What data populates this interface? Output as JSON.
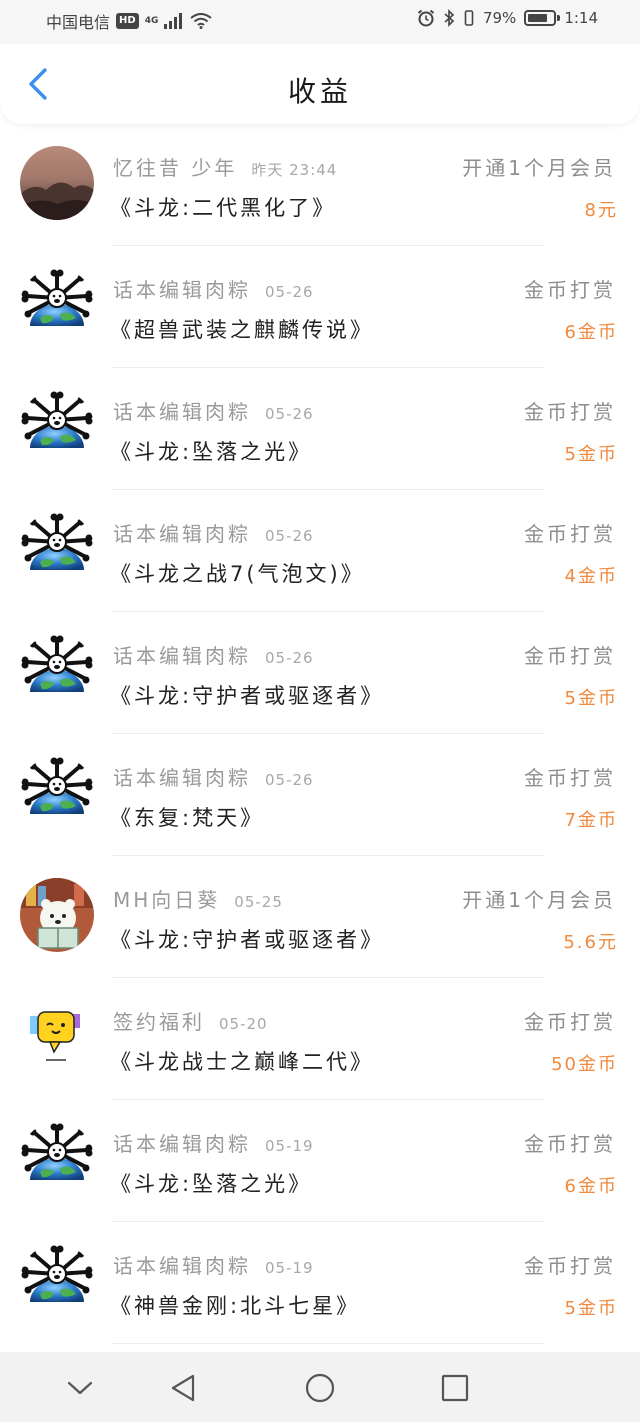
{
  "status_bar": {
    "carrier": "中国电信",
    "hd": "HD",
    "network": "4G",
    "battery_text": "79%",
    "battery_level": 0.79,
    "time": "1:14"
  },
  "header": {
    "title": "收益",
    "back_icon": "chevron-left-icon"
  },
  "colors": {
    "accent_blue": "#3b8ff0",
    "amount_orange": "#f08a3e"
  },
  "rows": [
    {
      "avatar": "mountain-photo",
      "name": "忆往昔 少年",
      "time": "昨天 23:44",
      "type": "开通1个月会员",
      "title": "《斗龙:二代黑化了》",
      "amount": "8元"
    },
    {
      "avatar": "bone-globe",
      "name": "话本编辑肉粽",
      "time": "05-26",
      "type": "金币打赏",
      "title": "《超兽武装之麒麟传说》",
      "amount": "6金币"
    },
    {
      "avatar": "bone-globe",
      "name": "话本编辑肉粽",
      "time": "05-26",
      "type": "金币打赏",
      "title": "《斗龙:坠落之光》",
      "amount": "5金币"
    },
    {
      "avatar": "bone-globe",
      "name": "话本编辑肉粽",
      "time": "05-26",
      "type": "金币打赏",
      "title": "《斗龙之战7(气泡文)》",
      "amount": "4金币"
    },
    {
      "avatar": "bone-globe",
      "name": "话本编辑肉粽",
      "time": "05-26",
      "type": "金币打赏",
      "title": "《斗龙:守护者或驱逐者》",
      "amount": "5金币"
    },
    {
      "avatar": "bone-globe",
      "name": "话本编辑肉粽",
      "time": "05-26",
      "type": "金币打赏",
      "title": "《东复:梵天》",
      "amount": "7金币"
    },
    {
      "avatar": "bear-reading",
      "name": "MH向日葵",
      "time": "05-25",
      "type": "开通1个月会员",
      "title": "《斗龙:守护者或驱逐者》",
      "amount": "5.6元"
    },
    {
      "avatar": "chat-bubble",
      "name": "签约福利",
      "time": "05-20",
      "type": "金币打赏",
      "title": "《斗龙战士之巅峰二代》",
      "amount": "50金币"
    },
    {
      "avatar": "bone-globe",
      "name": "话本编辑肉粽",
      "time": "05-19",
      "type": "金币打赏",
      "title": "《斗龙:坠落之光》",
      "amount": "6金币"
    },
    {
      "avatar": "bone-globe",
      "name": "话本编辑肉粽",
      "time": "05-19",
      "type": "金币打赏",
      "title": "《神兽金刚:北斗七星》",
      "amount": "5金币"
    }
  ],
  "nav_bar": {
    "buttons": [
      "collapse-chevron-icon",
      "back-triangle-icon",
      "home-circle-icon",
      "recents-square-icon"
    ]
  }
}
